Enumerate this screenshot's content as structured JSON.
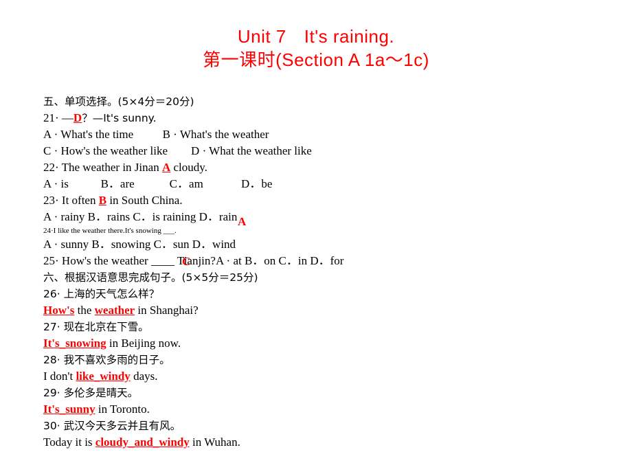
{
  "title": {
    "line1_left": "Unit 7",
    "line1_right": "It's raining.",
    "line2": "第一课时(Section A 1a～1c)"
  },
  "sections": [
    {
      "heading": "五、单项选择。(5×4分＝20分)",
      "items": [
        {
          "num": "21",
          "stem_before": "· —",
          "answer": "D",
          "stem_after": "？—It's sunny.",
          "options": [
            "A · What's the time",
            "B · What's the weather",
            "C · How's the weather like",
            "D · What the weather like"
          ],
          "options_line1": "A · What's the time          B · What's the weather",
          "options_line2": "C · How's the weather like        D · What the weather like"
        },
        {
          "num": "22",
          "stem_before": "· The weather in Jinan ",
          "answer": "A",
          "stem_after": " cloudy.",
          "options_line1": "A · is           B．are            C．am             D．be"
        },
        {
          "num": "23",
          "stem_before": "· It often ",
          "answer": "B",
          "stem_after": " in South China.",
          "options_line1": "A · rainy B．rains C．is raining D．rain"
        },
        {
          "num": "24",
          "stem_small": "24·I like the weather there.It's snowing ___.",
          "answer": "A",
          "options_line1": "A · sunny B．snowing C．sun D．wind"
        },
        {
          "num": "25",
          "stem_before": "· How's the weather ____ Tianjin?",
          "answer": "C",
          "options_line1": "A · at B．on C．in D．for"
        }
      ]
    },
    {
      "heading": "六、根据汉语意思完成句子。(5×5分＝25分)",
      "items": [
        {
          "num": "26",
          "prompt": "· 上海的天气怎么样？",
          "answer_parts": [
            "How's",
            "weather"
          ],
          "answer_line_pre": "",
          "answer_line_mid": " the ",
          "answer_line_post": " in Shanghai?"
        },
        {
          "num": "27",
          "prompt": "· 现在北京在下雪。",
          "answer_parts": [
            "It's_snowing"
          ],
          "answer_line_post": " in Beijing now."
        },
        {
          "num": "28",
          "prompt": "· 我不喜欢多雨的日子。",
          "answer_line_pre": "I don't ",
          "answer_parts": [
            "like_windy"
          ],
          "answer_line_post": " days."
        },
        {
          "num": "29",
          "prompt": "· 多伦多是晴天。",
          "answer_parts": [
            "It's_sunny"
          ],
          "answer_line_post": " in Toronto."
        },
        {
          "num": "30",
          "prompt": "· 武汉今天多云并且有风。",
          "answer_line_pre": "Today it is ",
          "answer_parts": [
            "cloudy_and_windy"
          ],
          "answer_line_post": " in Wuhan."
        }
      ]
    }
  ],
  "colors": {
    "accent_red": "#ff0000",
    "text_black": "#000000",
    "background": "#ffffff"
  }
}
